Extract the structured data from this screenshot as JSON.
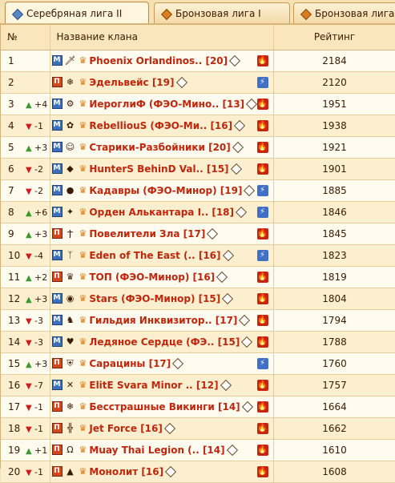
{
  "tabs": [
    {
      "label": "Серебряная лига II",
      "active": true,
      "icon": "silver-league-icon"
    },
    {
      "label": "Бронзовая лига I",
      "active": false,
      "icon": "bronze-league-icon"
    },
    {
      "label": "Бронзовая лига II",
      "active": false,
      "icon": "bronze-league-icon"
    }
  ],
  "headers": {
    "num": "№",
    "clan": "Название клана",
    "rating": "Рейтинг"
  },
  "colors": {
    "name": "#c0260c",
    "up": "#3a9a2a",
    "down": "#d11a1a",
    "fire": "#c6240c",
    "bolt": "#3f70c6"
  },
  "rows": [
    {
      "pos": "1",
      "dir": "",
      "change": "",
      "badge": "M",
      "emblem": "🗡",
      "name": "Phoenix Orlandinos.. [20]",
      "element": "fire",
      "rating": "2184"
    },
    {
      "pos": "2",
      "dir": "",
      "change": "",
      "badge": "П",
      "emblem": "❄",
      "name": "Эдельвейс [19]",
      "element": "bolt",
      "rating": "2120"
    },
    {
      "pos": "3",
      "dir": "up",
      "change": "+4",
      "badge": "M",
      "emblem": "⚙",
      "name": "ИероглиФ (ФЭО-Мино.. [13]",
      "element": "fire",
      "rating": "1951"
    },
    {
      "pos": "4",
      "dir": "down",
      "change": "-1",
      "badge": "M",
      "emblem": "✿",
      "name": "RebelliouS (ФЭО-Ми.. [16]",
      "element": "fire",
      "rating": "1938"
    },
    {
      "pos": "5",
      "dir": "up",
      "change": "+3",
      "badge": "M",
      "emblem": "☺",
      "name": "Старики-Разбойники [20]",
      "element": "fire",
      "rating": "1921"
    },
    {
      "pos": "6",
      "dir": "down",
      "change": "-2",
      "badge": "M",
      "emblem": "◆",
      "name": "HunterS BehinD Val.. [15]",
      "element": "fire",
      "rating": "1901"
    },
    {
      "pos": "7",
      "dir": "down",
      "change": "-2",
      "badge": "M",
      "emblem": "●",
      "name": "Кадавры (ФЭО-Минор) [19]",
      "element": "bolt",
      "rating": "1885"
    },
    {
      "pos": "8",
      "dir": "up",
      "change": "+6",
      "badge": "M",
      "emblem": "✦",
      "name": "Орден Алькантара I.. [18]",
      "element": "bolt",
      "rating": "1846"
    },
    {
      "pos": "9",
      "dir": "up",
      "change": "+3",
      "badge": "П",
      "emblem": "Ϯ",
      "name": "Повелители Зла [17]",
      "element": "fire",
      "rating": "1845"
    },
    {
      "pos": "10",
      "dir": "down",
      "change": "-4",
      "badge": "M",
      "emblem": "ᛉ",
      "name": "Eden of The East (.. [16]",
      "element": "bolt",
      "rating": "1823"
    },
    {
      "pos": "11",
      "dir": "up",
      "change": "+2",
      "badge": "П",
      "emblem": "♛",
      "name": "ТОП (ФЭО-Минор) [16]",
      "element": "fire",
      "rating": "1819"
    },
    {
      "pos": "12",
      "dir": "up",
      "change": "+3",
      "badge": "M",
      "emblem": "◉",
      "name": "Stars (ФЭО-Минор) [15]",
      "element": "fire",
      "rating": "1804"
    },
    {
      "pos": "13",
      "dir": "down",
      "change": "-3",
      "badge": "M",
      "emblem": "♞",
      "name": "Гильдия Инквизитор.. [17]",
      "element": "fire",
      "rating": "1794"
    },
    {
      "pos": "14",
      "dir": "down",
      "change": "-3",
      "badge": "M",
      "emblem": "♥",
      "name": "Ледяное Сердце (ФЭ.. [15]",
      "element": "fire",
      "rating": "1788"
    },
    {
      "pos": "15",
      "dir": "up",
      "change": "+3",
      "badge": "П",
      "emblem": "⛨",
      "name": "Сарацины [17]",
      "element": "bolt",
      "rating": "1760"
    },
    {
      "pos": "16",
      "dir": "down",
      "change": "-7",
      "badge": "M",
      "emblem": "✕",
      "name": "ElitE Svara Minor .. [12]",
      "element": "fire",
      "rating": "1757"
    },
    {
      "pos": "17",
      "dir": "down",
      "change": "-1",
      "badge": "П",
      "emblem": "❄",
      "name": "Бесстрашные Викинги [14]",
      "element": "fire",
      "rating": "1664"
    },
    {
      "pos": "18",
      "dir": "down",
      "change": "-1",
      "badge": "П",
      "emblem": "╬",
      "name": "Jet Force [16]",
      "element": "fire",
      "rating": "1662"
    },
    {
      "pos": "19",
      "dir": "up",
      "change": "+1",
      "badge": "П",
      "emblem": "Ω",
      "name": "Muay Thai Legion (.. [14]",
      "element": "fire",
      "rating": "1610"
    },
    {
      "pos": "20",
      "dir": "down",
      "change": "-1",
      "badge": "П",
      "emblem": "▲",
      "name": "Монолит [16]",
      "element": "fire",
      "rating": "1608"
    }
  ]
}
